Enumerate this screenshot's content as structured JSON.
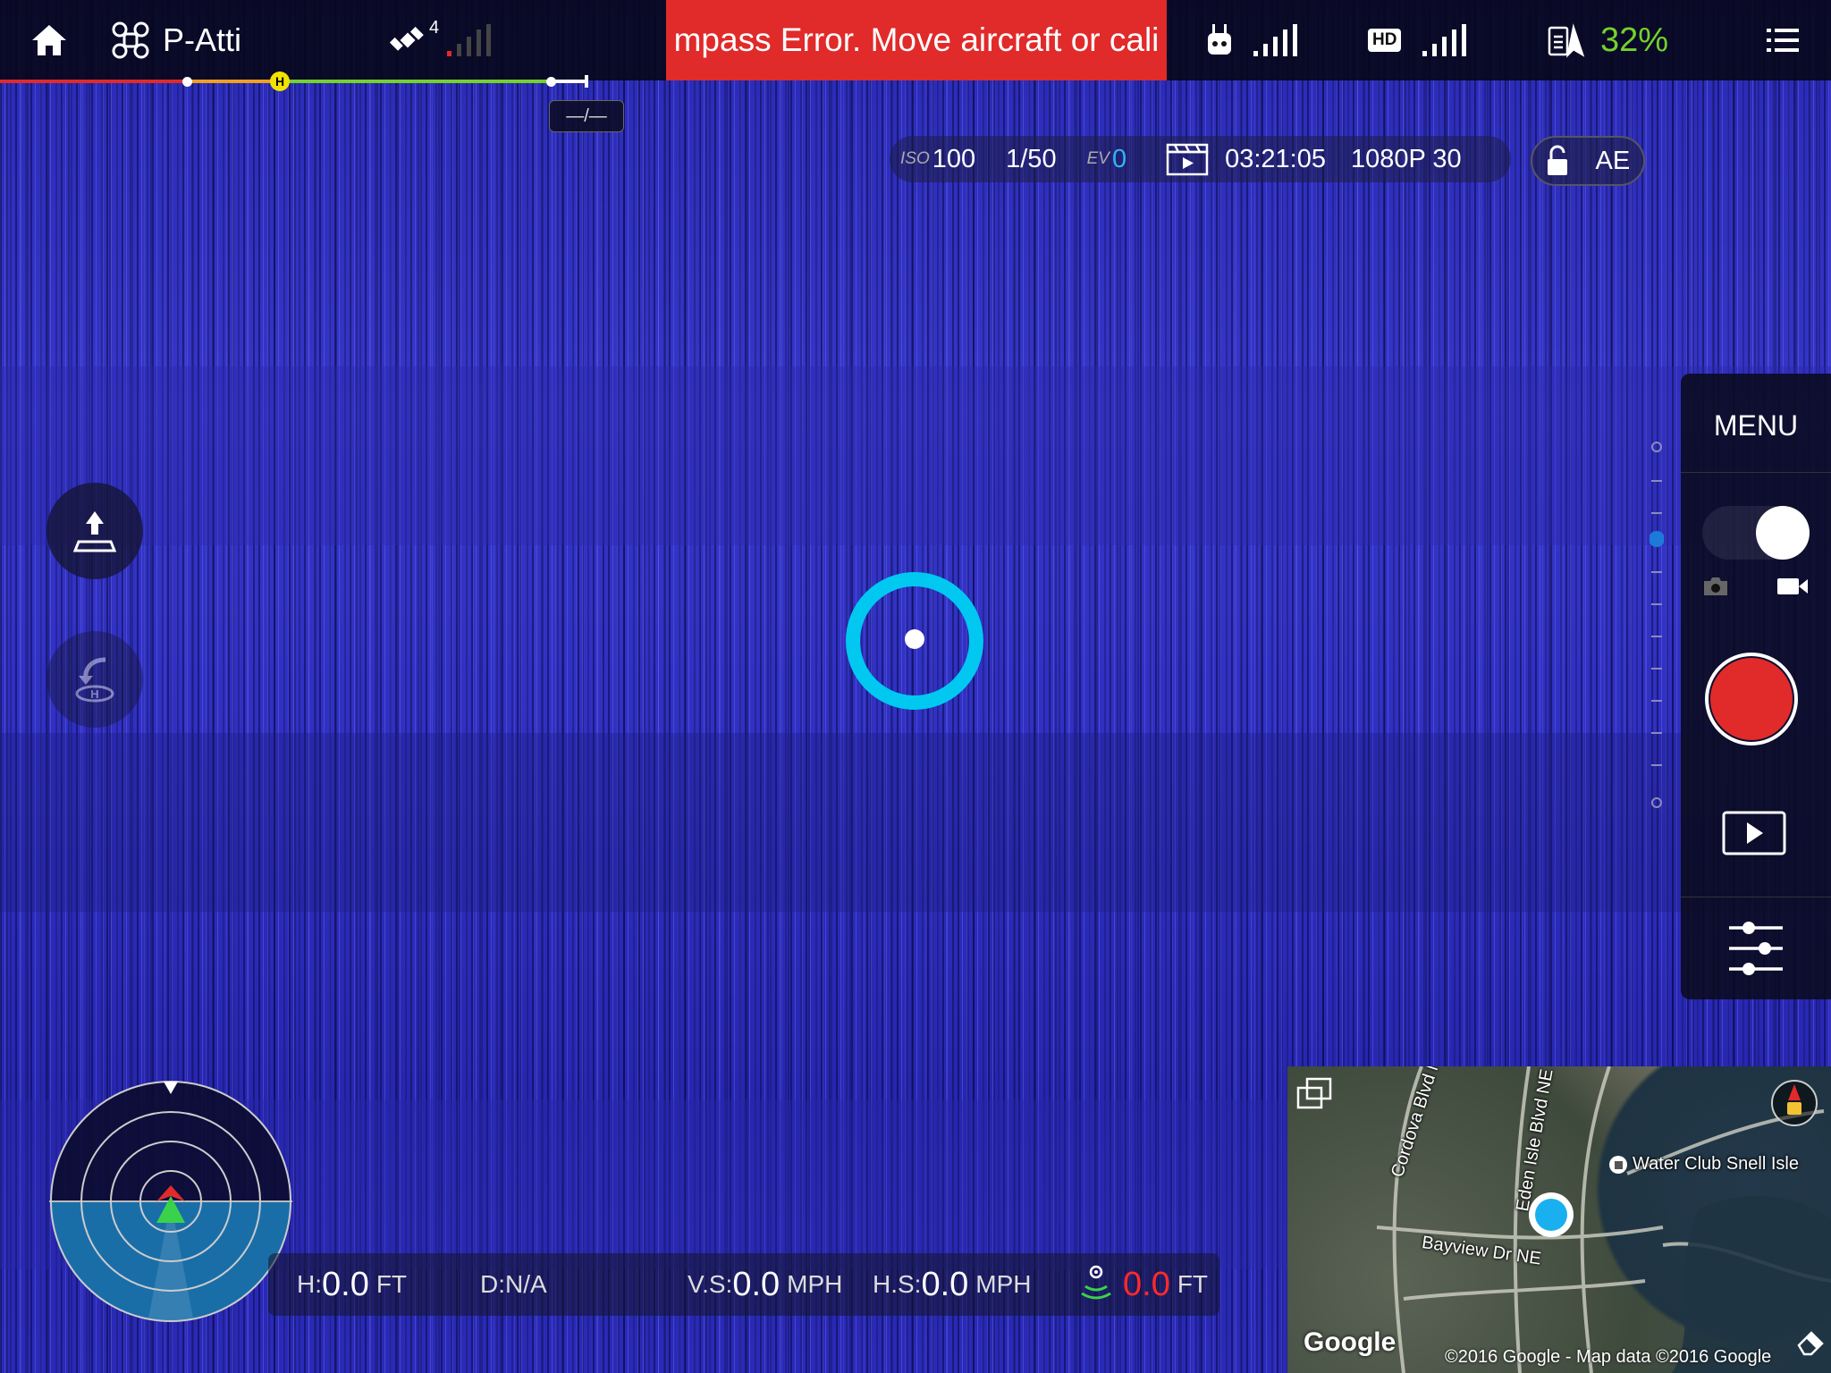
{
  "top_bar": {
    "flight_mode": "P-Atti",
    "satellite_count": "4",
    "error_banner": "mpass Error. Move aircraft or cali",
    "hd_badge": "HD",
    "battery_percent": "32%"
  },
  "distance_tag": "—/—",
  "camera": {
    "iso_label": "ISO",
    "iso_value": "100",
    "shutter": "1/50",
    "ev_label": "EV",
    "ev_value": "0",
    "record_time": "03:21:05",
    "resolution": "1080P 30",
    "ae_label": "AE"
  },
  "right_panel": {
    "menu_label": "MENU"
  },
  "telemetry": {
    "height_label": "H:",
    "height_value": "0.0",
    "height_unit": "FT",
    "distance_label": "D:N/A",
    "vs_label": "V.S:",
    "vs_value": "0.0",
    "vs_unit": "MPH",
    "hs_label": "H.S:",
    "hs_value": "0.0",
    "hs_unit": "MPH",
    "vps_value": "0.0",
    "vps_unit": "FT"
  },
  "map": {
    "labels": {
      "cordova": "Cordova Blvd NE",
      "eden": "Eden Isle Blvd NE",
      "bayview": "Bayview Dr NE",
      "poi": "Water Club Snell Isle"
    },
    "google_logo": "Google",
    "copyright": "©2016 Google - Map data ©2016 Google"
  },
  "colors": {
    "error_red": "#e12a2a",
    "battery_green": "#74d22b",
    "target_cyan": "#00c8f0",
    "ev_blue": "#2fb6f1"
  }
}
